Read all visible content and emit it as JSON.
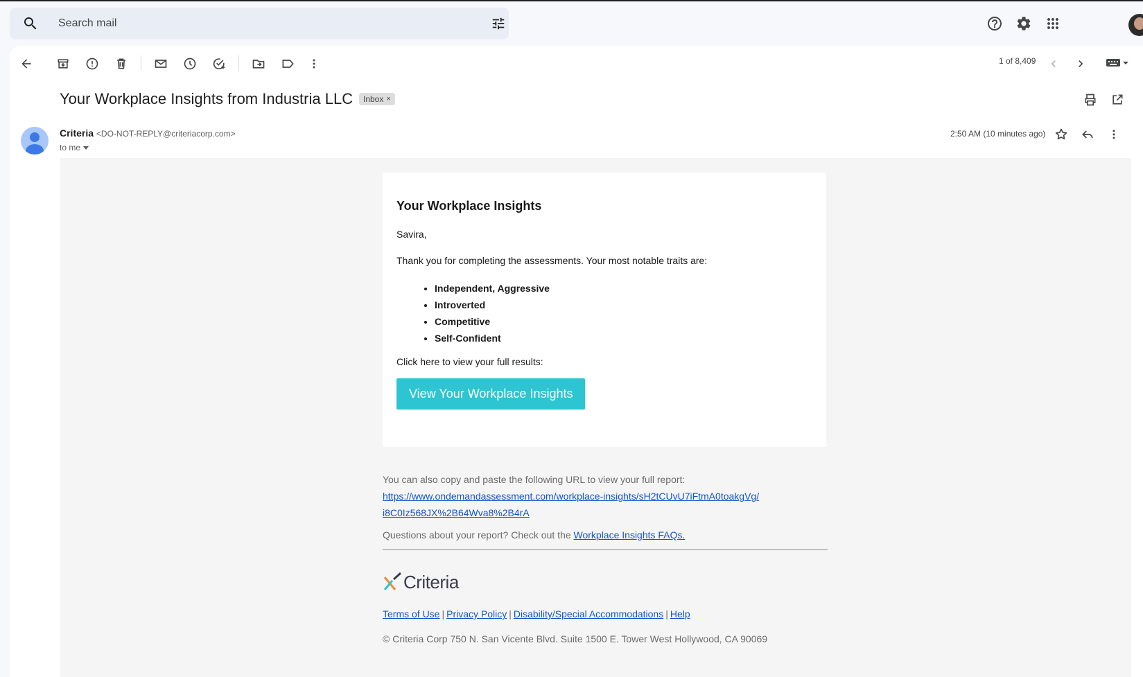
{
  "search": {
    "placeholder": "Search mail"
  },
  "toolbar": {
    "counter": "1 of 8,409"
  },
  "email": {
    "subject": "Your Workplace Insights from Industria LLC",
    "label_chip": "Inbox",
    "chip_close": "×",
    "sender_name": "Criteria",
    "sender_email": "<DO-NOT-REPLY@criteriacorp.com>",
    "recipient": "to me",
    "timestamp": "2:50 AM (10 minutes ago)"
  },
  "body": {
    "heading": "Your Workplace Insights",
    "greeting": "Savira,",
    "intro": "Thank you for completing the assessments. Your most notable traits are:",
    "traits": [
      "Independent, Aggressive",
      "Introverted",
      "Competitive",
      "Self-Confident"
    ],
    "click_text": "Click here to view your full results:",
    "cta_label": "View Your Workplace Insights"
  },
  "footer": {
    "copy_text": "You can also copy and paste the following URL to view your full report:",
    "url_line1": "https://www.ondemandassessment.com/workplace-insights/sH2tCUvU7iFtmA0toakgVg/",
    "url_line2": "i8C0Iz568JX%2B64Wva8%2B4rA",
    "faq_text": "Questions about your report? Check out the ",
    "faq_link": "Workplace Insights FAQs.",
    "logo_text": "Criteria",
    "links": [
      "Terms of Use",
      "Privacy Policy",
      "Disability/Special Accommodations",
      "Help"
    ],
    "link_separator": "|",
    "copyright": "© Criteria Corp 750 N. San Vicente Blvd. Suite 1500 E. Tower West Hollywood, CA 90069"
  },
  "colors": {
    "cta": "#2dc5d2",
    "link": "#1155cc",
    "search_bg": "#e9eef6"
  },
  "icons": [
    "search-icon",
    "tune-icon",
    "help-icon",
    "settings-icon",
    "apps-icon",
    "back-icon",
    "archive-icon",
    "report-spam-icon",
    "delete-icon",
    "mark-unread-icon",
    "snooze-icon",
    "add-task-icon",
    "move-to-icon",
    "label-icon",
    "more-icon",
    "prev-icon",
    "next-icon",
    "keyboard-icon",
    "print-icon",
    "open-new-window-icon",
    "star-icon",
    "reply-icon"
  ]
}
